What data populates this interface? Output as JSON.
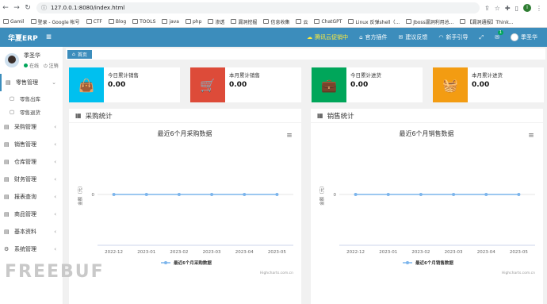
{
  "browser": {
    "url": "127.0.0.1:8080/index.html",
    "profile_initial": "I",
    "bookmarks": [
      "Gamil",
      "登录 - Google 帐号",
      "CTF",
      "Blog",
      "TOOLS",
      "java",
      "php",
      "渗透",
      "漏洞挖掘",
      "信息收集",
      "云",
      "ChatGPT",
      "Linux 反弹shell（...",
      "Jboss漏洞利用总...",
      "【漏洞通报】Think..."
    ]
  },
  "header": {
    "brand": "华夏ERP",
    "promo": "腾讯云促销中",
    "plugins": "官方插件",
    "feedback": "建议反馈",
    "guide": "新手引导",
    "mail_badge": "1",
    "username": "季圣华"
  },
  "sidebar": {
    "user_name": "季圣华",
    "status": "在线",
    "logout": "注销",
    "items": [
      {
        "label": "零售管理",
        "icon": "▤"
      },
      {
        "label": "零售出库",
        "icon": "▢"
      },
      {
        "label": "零售退货",
        "icon": "▢"
      },
      {
        "label": "采购管理",
        "icon": "▤"
      },
      {
        "label": "销售管理",
        "icon": "▤"
      },
      {
        "label": "仓库管理",
        "icon": "▤"
      },
      {
        "label": "财务管理",
        "icon": "▤"
      },
      {
        "label": "报表查询",
        "icon": "▤"
      },
      {
        "label": "商品管理",
        "icon": "▤"
      },
      {
        "label": "基本资料",
        "icon": "▤"
      },
      {
        "label": "系统管理",
        "icon": "⚙"
      }
    ]
  },
  "breadcrumb": "首页",
  "stats": [
    {
      "label": "今日累计销售",
      "value": "0.00",
      "color": "#00c0ef",
      "icon": "shopping-bag-icon"
    },
    {
      "label": "本月累计销售",
      "value": "0.00",
      "color": "#dd4b39",
      "icon": "shopping-cart-icon"
    },
    {
      "label": "今日累计进货",
      "value": "0.00",
      "color": "#00a65a",
      "icon": "briefcase-icon"
    },
    {
      "label": "本月累计进货",
      "value": "0.00",
      "color": "#f39c12",
      "icon": "basket-icon"
    }
  ],
  "panels": [
    {
      "title": "采购统计"
    },
    {
      "title": "销售统计"
    }
  ],
  "chart_data": [
    {
      "type": "line",
      "title": "最近6个月采购数据",
      "xlabel": "",
      "ylabel": "金额（元）",
      "categories": [
        "2022-12",
        "2023-01",
        "2023-02",
        "2023-03",
        "2023-04",
        "2023-05"
      ],
      "series": [
        {
          "name": "最近6个月采购数据",
          "values": [
            0,
            0,
            0,
            0,
            0,
            0
          ]
        }
      ],
      "yticks": [
        "0"
      ],
      "credit": "Highcharts.com.cn",
      "legend": "bottom",
      "color": "#7cb5ec"
    },
    {
      "type": "line",
      "title": "最近6个月销售数据",
      "xlabel": "",
      "ylabel": "金额（元）",
      "categories": [
        "2022-12",
        "2023-01",
        "2023-02",
        "2023-03",
        "2023-04",
        "2023-05"
      ],
      "series": [
        {
          "name": "最近6个月销售数据",
          "values": [
            0,
            0,
            0,
            0,
            0,
            0
          ]
        }
      ],
      "yticks": [
        "0"
      ],
      "credit": "Highcharts.com.cn",
      "legend": "bottom",
      "color": "#7cb5ec"
    }
  ],
  "watermark": "FREEBUF"
}
